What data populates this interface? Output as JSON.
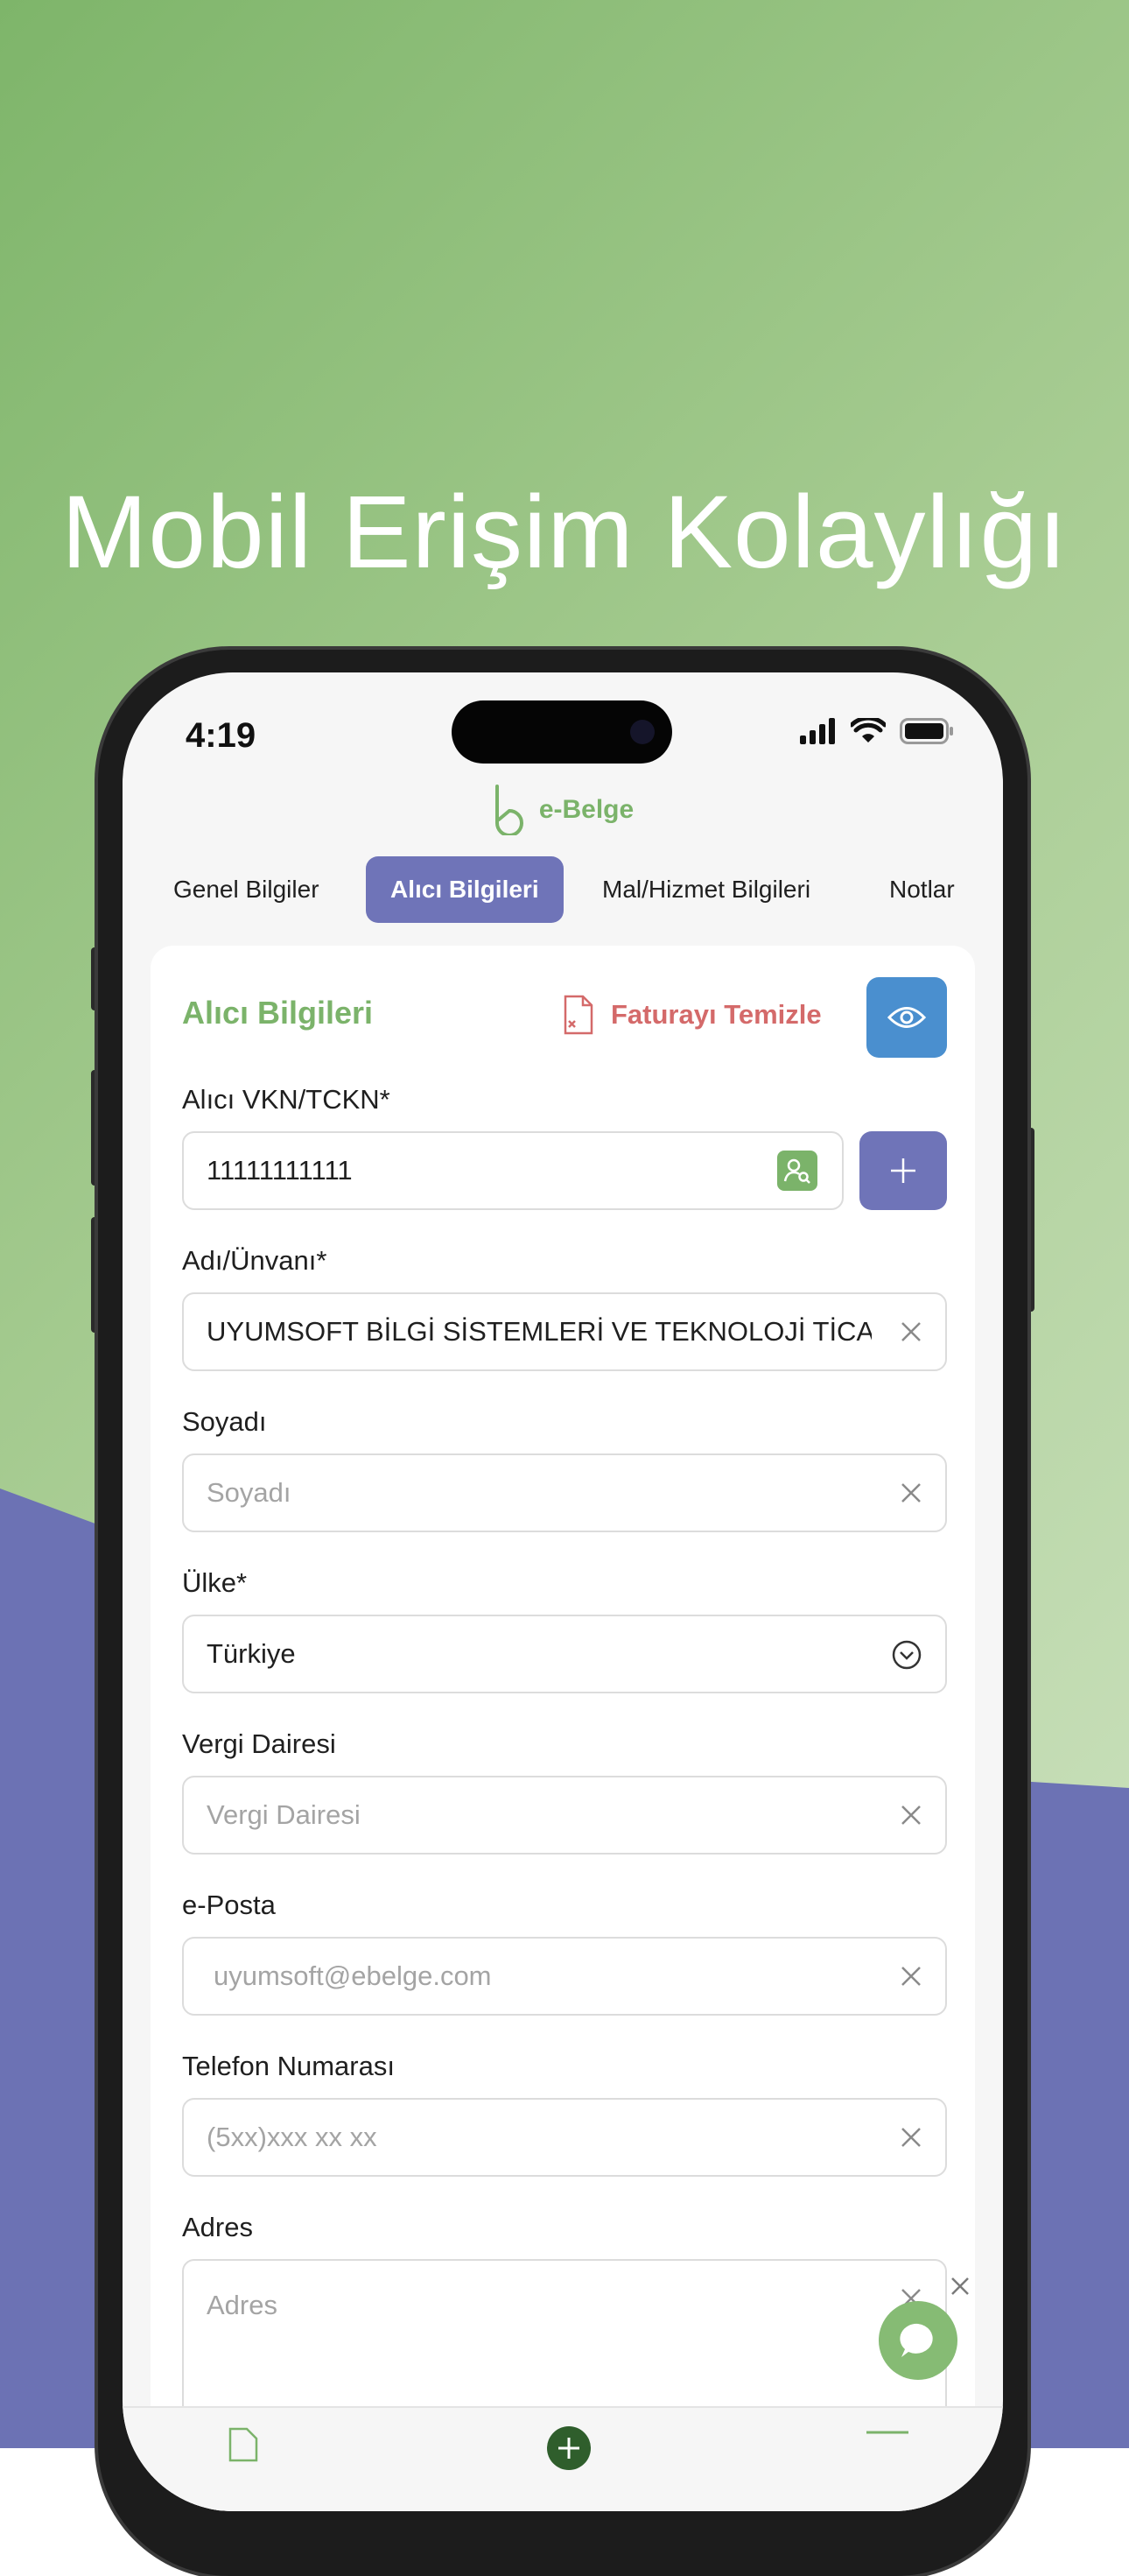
{
  "colors": {
    "green": "#7bb36a",
    "purple": "#6f74b8",
    "blue": "#4a8fcf",
    "red": "#d46a6a"
  },
  "headline": "Mobil Erişim Kolaylığı",
  "status": {
    "time": "4:19"
  },
  "app": {
    "logo_text": "e-Belge"
  },
  "tabs": [
    {
      "label": "Genel Bilgiler",
      "active": false
    },
    {
      "label": "Alıcı Bilgileri",
      "active": true
    },
    {
      "label": "Mal/Hizmet Bilgileri",
      "active": false
    },
    {
      "label": "Notlar",
      "active": false
    }
  ],
  "form": {
    "title": "Alıcı Bilgileri",
    "clear_label": "Faturayı Temizle",
    "vkn": {
      "label": "Alıcı VKN/TCKN*",
      "value": "11111111111"
    },
    "name": {
      "label": "Adı/Ünvanı*",
      "value": "UYUMSOFT BİLGİ SİSTEMLERİ VE TEKNOLOJİ TİCA.."
    },
    "surname": {
      "label": "Soyadı",
      "placeholder": "Soyadı"
    },
    "country": {
      "label": "Ülke*",
      "value": "Türkiye"
    },
    "tax_office": {
      "label": "Vergi Dairesi",
      "placeholder": "Vergi Dairesi"
    },
    "email": {
      "label": "e-Posta",
      "placeholder": "uyumsoft@ebelge.com"
    },
    "phone": {
      "label": "Telefon Numarası",
      "placeholder": "(5xx)xxx xx xx"
    },
    "address": {
      "label": "Adres",
      "placeholder": "Adres"
    }
  }
}
